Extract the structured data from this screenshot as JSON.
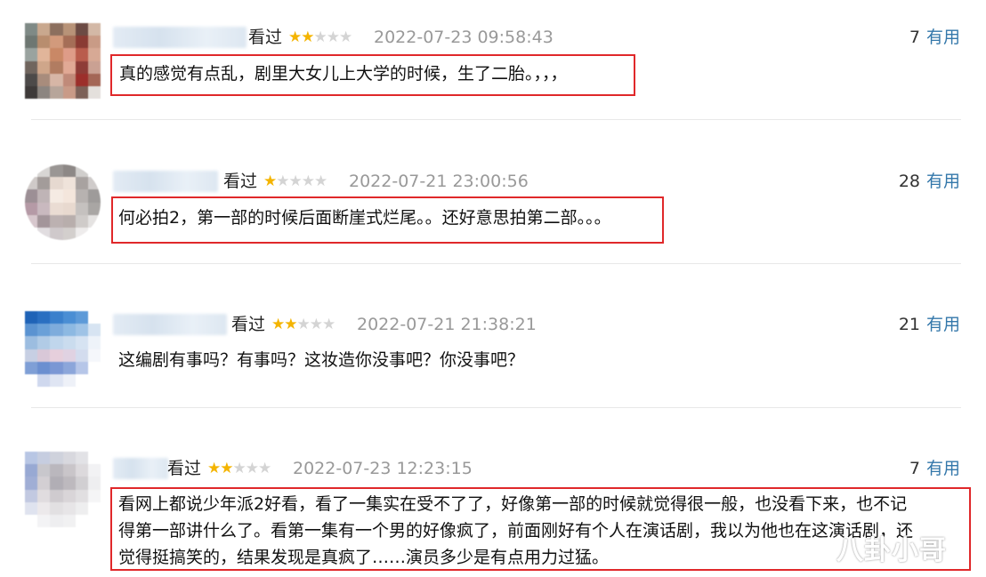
{
  "reviews": [
    {
      "seen": "看过",
      "rating": 2,
      "time": "2022-07-23 09:58:43",
      "votes": "7",
      "useful": "有用",
      "lines": [
        "真的感觉有点乱，剧里大女儿上大学的时候，生了二胎。，，，"
      ],
      "highlighted": true
    },
    {
      "seen": "看过",
      "rating": 1,
      "time": "2022-07-21 23:00:56",
      "votes": "28",
      "useful": "有用",
      "lines": [
        "何必拍2，第一部的时候后面断崖式烂尾。。还好意思拍第二部。。。"
      ],
      "highlighted": true
    },
    {
      "seen": "看过",
      "rating": 2,
      "time": "2022-07-21 21:38:21",
      "votes": "21",
      "useful": "有用",
      "lines": [
        "这编剧有事吗？有事吗？这妆造你没事吧？你没事吧？"
      ],
      "highlighted": false
    },
    {
      "seen": "看过",
      "rating": 2,
      "time": "2022-07-23 12:23:15",
      "votes": "7",
      "useful": "有用",
      "lines": [
        "看网上都说少年派2好看，看了一集实在受不了了，好像第一部的时候就觉得很一般，也没看下来，也不记",
        "得第一部讲什么了。看第一集有一个男的好像疯了，前面刚好有个人在演话剧，我以为他也在这演话剧，还",
        "觉得挺搞笑的，结果发现是真疯了……演员多少是有点用力过猛。"
      ],
      "highlighted": true
    }
  ],
  "stars": {
    "on": "★",
    "off": "★"
  },
  "watermark": "八卦小哥",
  "colors": {
    "highlight": "#e0282a",
    "link": "#3377aa",
    "star": "#f4b400",
    "time": "#999999"
  }
}
